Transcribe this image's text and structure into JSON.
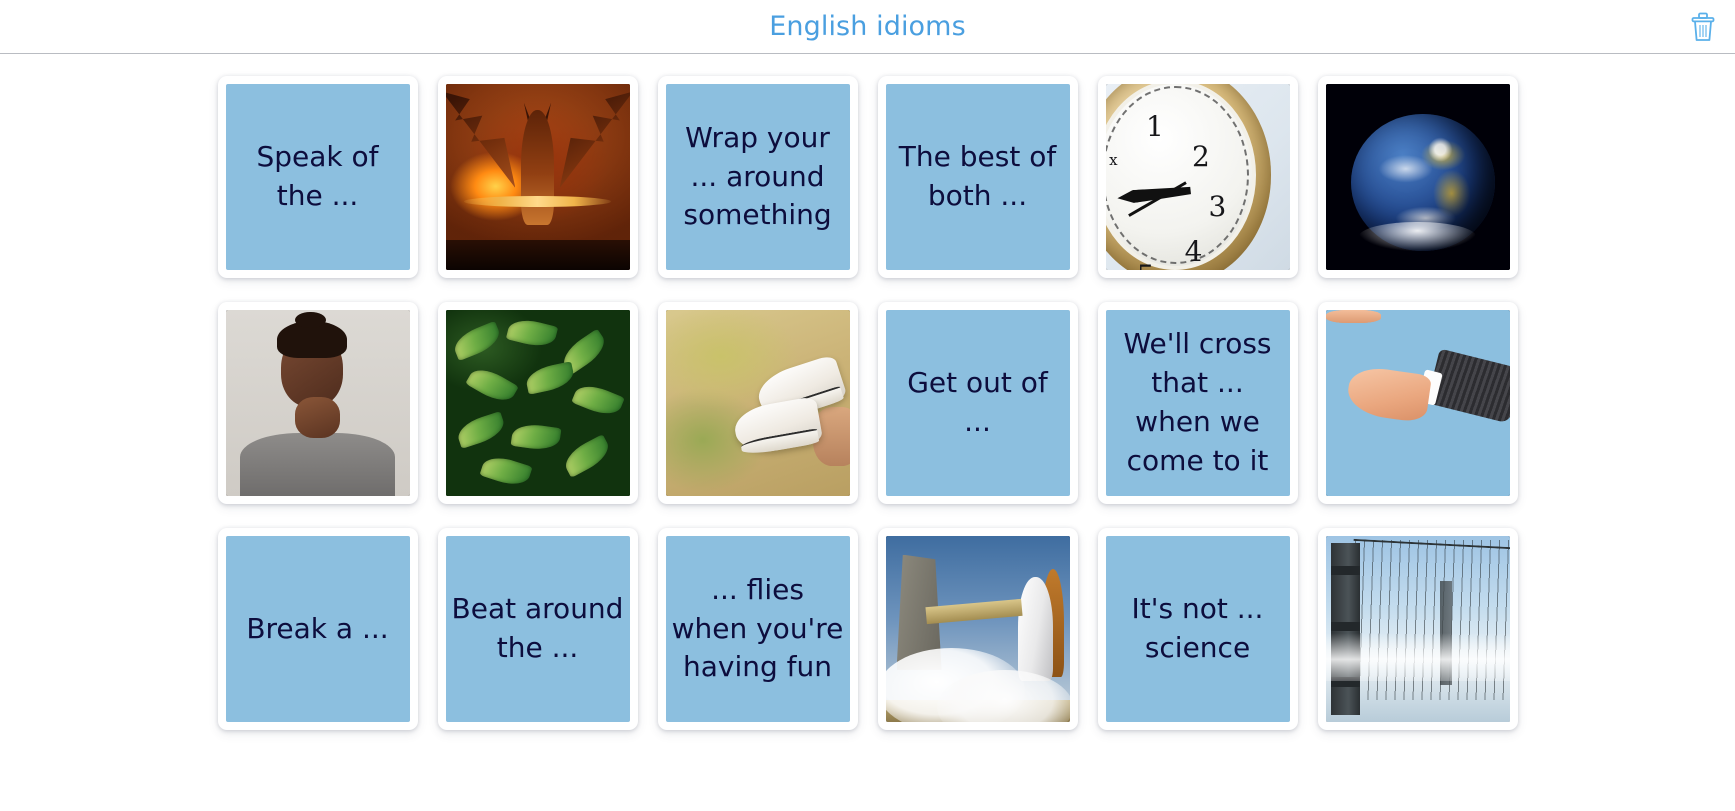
{
  "header": {
    "title": "English idioms",
    "delete_icon": "trash-icon",
    "accent_color": "#4a9fe0"
  },
  "board": {
    "card_back_color": "#8cbfdf",
    "card_text_color": "#0d0d3d",
    "rows": [
      [
        {
          "type": "text",
          "text": "Speak of the ...",
          "name": "card-speak-of-the"
        },
        {
          "type": "image",
          "art": "devil",
          "alt": "devil",
          "name": "card-image-devil"
        },
        {
          "type": "text",
          "text": "Wrap your ... around something",
          "name": "card-wrap-your-around-something"
        },
        {
          "type": "text",
          "text": "The best of both ...",
          "name": "card-the-best-of-both"
        },
        {
          "type": "image",
          "art": "clock",
          "alt": "clock",
          "name": "card-image-clock"
        },
        {
          "type": "image",
          "art": "earth",
          "alt": "earth",
          "name": "card-image-earth"
        }
      ],
      [
        {
          "type": "image",
          "art": "think",
          "alt": "person thinking",
          "name": "card-image-thinking-person"
        },
        {
          "type": "image",
          "art": "leaves",
          "alt": "leaves",
          "name": "card-image-leaves"
        },
        {
          "type": "image",
          "art": "shoes",
          "alt": "sneakers",
          "name": "card-image-sneakers"
        },
        {
          "type": "text",
          "text": "Get out of ...",
          "name": "card-get-out-of"
        },
        {
          "type": "text",
          "text": "We'll cross that ... when we come to it",
          "name": "card-well-cross-that-when-we-come-to-it"
        },
        {
          "type": "image",
          "art": "hands",
          "alt": "handshake",
          "name": "card-image-handshake"
        }
      ],
      [
        {
          "type": "text",
          "text": "Break a ...",
          "name": "card-break-a"
        },
        {
          "type": "text",
          "text": "Beat around the ...",
          "name": "card-beat-around-the"
        },
        {
          "type": "text",
          "text": "... flies when you're having fun",
          "name": "card-flies-when-youre-having-fun"
        },
        {
          "type": "image",
          "art": "rocket",
          "alt": "rocket launch",
          "name": "card-image-rocket-launch"
        },
        {
          "type": "text",
          "text": "It's not ... science",
          "name": "card-its-not-science"
        },
        {
          "type": "image",
          "art": "bridge",
          "alt": "golden gate bridge",
          "name": "card-image-bridge"
        }
      ]
    ]
  }
}
